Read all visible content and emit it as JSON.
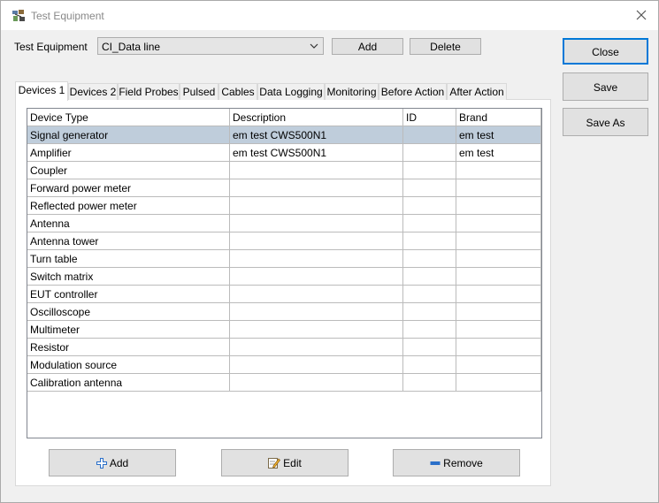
{
  "window": {
    "title": "Test Equipment"
  },
  "header": {
    "label": "Test Equipment",
    "selected": "CI_Data line",
    "add_label": "Add",
    "delete_label": "Delete"
  },
  "side_buttons": {
    "close": "Close",
    "save": "Save",
    "save_as": "Save As"
  },
  "tabs": [
    "Devices 1",
    "Devices 2",
    "Field Probes",
    "Pulsed",
    "Cables",
    "Data Logging",
    "Monitoring",
    "Before Action",
    "After Action"
  ],
  "active_tab": "Devices 1",
  "table": {
    "columns": [
      "Device Type",
      "Description",
      "ID",
      "Brand"
    ],
    "rows": [
      [
        "Signal generator",
        "em test CWS500N1",
        "",
        "em test"
      ],
      [
        "Amplifier",
        "em test CWS500N1",
        "",
        "em test"
      ],
      [
        "Coupler",
        "",
        "",
        ""
      ],
      [
        "Forward power meter",
        "",
        "",
        ""
      ],
      [
        "Reflected power meter",
        "",
        "",
        ""
      ],
      [
        "Antenna",
        "",
        "",
        ""
      ],
      [
        "Antenna tower",
        "",
        "",
        ""
      ],
      [
        "Turn table",
        "",
        "",
        ""
      ],
      [
        "Switch matrix",
        "",
        "",
        ""
      ],
      [
        "EUT controller",
        "",
        "",
        ""
      ],
      [
        "Oscilloscope",
        "",
        "",
        ""
      ],
      [
        "Multimeter",
        "",
        "",
        ""
      ],
      [
        "Resistor",
        "",
        "",
        ""
      ],
      [
        "Modulation source",
        "",
        "",
        ""
      ],
      [
        "Calibration antenna",
        "",
        "",
        ""
      ]
    ],
    "selected_row": "Signal generator"
  },
  "bottom_buttons": {
    "add": "Add",
    "edit": "Edit",
    "remove": "Remove"
  },
  "colors": {
    "accent": "#0078d7",
    "selected_row": "#bfcddb"
  }
}
